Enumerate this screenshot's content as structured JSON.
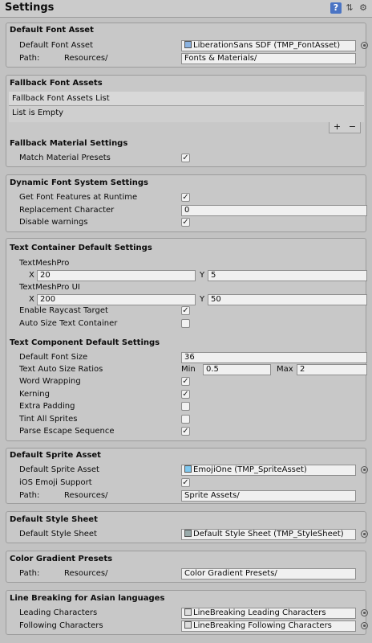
{
  "header": {
    "title": "Settings"
  },
  "default_font_asset": {
    "title": "Default Font Asset",
    "font_label": "Default Font Asset",
    "font_value": "LiberationSans SDF (TMP_FontAsset)",
    "path_label": "Path:",
    "path_prefix": "Resources/",
    "path_value": "Fonts & Materials/"
  },
  "fallback": {
    "title": "Fallback Font Assets",
    "list_header": "Fallback Font Assets List",
    "list_empty": "List is Empty",
    "add": "+",
    "remove": "−",
    "material_title": "Fallback Material Settings",
    "match_label": "Match Material Presets",
    "match_checked": true
  },
  "dynamic": {
    "title": "Dynamic Font System Settings",
    "features_label": "Get Font Features at Runtime",
    "features_checked": true,
    "replacement_label": "Replacement Character",
    "replacement_value": "0",
    "disable_label": "Disable warnings",
    "disable_checked": true
  },
  "container": {
    "title": "Text Container Default Settings",
    "tmp_label": "TextMeshPro",
    "tmp_x_label": "X",
    "tmp_x": "20",
    "tmp_y_label": "Y",
    "tmp_y": "5",
    "tmpui_label": "TextMeshPro UI",
    "tmpui_x_label": "X",
    "tmpui_x": "200",
    "tmpui_y_label": "Y",
    "tmpui_y": "50",
    "raycast_label": "Enable Raycast Target",
    "raycast_checked": true,
    "autosize_label": "Auto Size Text Container",
    "autosize_checked": false
  },
  "component": {
    "title": "Text Component Default Settings",
    "font_size_label": "Default Font Size",
    "font_size": "36",
    "ratios_label": "Text Auto Size Ratios",
    "min_label": "Min",
    "min": "0.5",
    "max_label": "Max",
    "max": "2",
    "wrap_label": "Word Wrapping",
    "wrap_checked": true,
    "kerning_label": "Kerning",
    "kerning_checked": true,
    "padding_label": "Extra Padding",
    "padding_checked": false,
    "tint_label": "Tint All Sprites",
    "tint_checked": false,
    "escape_label": "Parse Escape Sequence",
    "escape_checked": true
  },
  "sprite": {
    "title": "Default Sprite Asset",
    "asset_label": "Default Sprite Asset",
    "asset_value": "EmojiOne (TMP_SpriteAsset)",
    "ios_label": "iOS Emoji Support",
    "ios_checked": true,
    "path_label": "Path:",
    "path_prefix": "Resources/",
    "path_value": "Sprite Assets/"
  },
  "style": {
    "title": "Default Style Sheet",
    "sheet_label": "Default Style Sheet",
    "sheet_value": "Default Style Sheet (TMP_StyleSheet)"
  },
  "gradient": {
    "title": "Color Gradient Presets",
    "path_label": "Path:",
    "path_prefix": "Resources/",
    "path_value": "Color Gradient Presets/"
  },
  "linebreak": {
    "title": "Line Breaking for Asian languages",
    "leading_label": "Leading Characters",
    "leading_value": "LineBreaking Leading Characters",
    "following_label": "Following Characters",
    "following_value": "LineBreaking Following Characters"
  }
}
